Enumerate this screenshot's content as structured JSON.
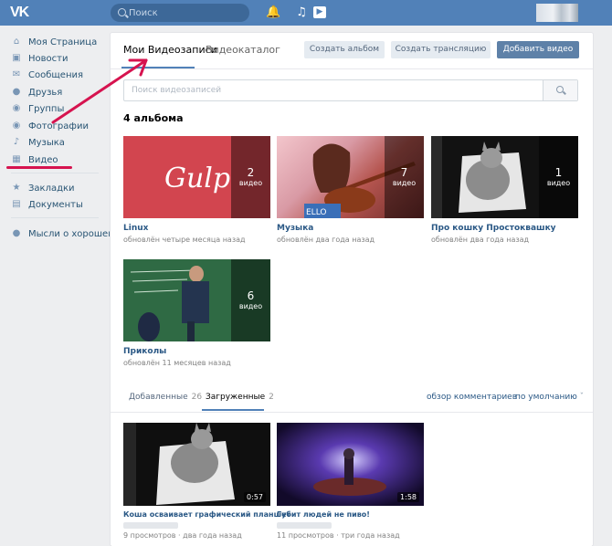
{
  "header": {
    "search_placeholder": "Поиск",
    "logo_icon": "vk-logo-icon",
    "icons": [
      "bell-icon",
      "music-icon",
      "play-icon"
    ]
  },
  "sidebar": {
    "items": [
      {
        "label": "Моя Страница",
        "icon": "home-icon"
      },
      {
        "label": "Новости",
        "icon": "news-icon"
      },
      {
        "label": "Сообщения",
        "icon": "messages-icon"
      },
      {
        "label": "Друзья",
        "icon": "friends-icon"
      },
      {
        "label": "Группы",
        "icon": "groups-icon"
      },
      {
        "label": "Фотографии",
        "icon": "camera-icon"
      },
      {
        "label": "Музыка",
        "icon": "music-icon"
      },
      {
        "label": "Видео",
        "icon": "video-icon"
      },
      {
        "label": "Закладки",
        "icon": "star-icon"
      },
      {
        "label": "Документы",
        "icon": "document-icon"
      },
      {
        "label": "Мысли о хорошем...",
        "icon": "community-icon"
      }
    ]
  },
  "main": {
    "tabs": [
      {
        "label": "Мои Видеозаписи",
        "active": true
      },
      {
        "label": "Видеокаталог",
        "active": false
      }
    ],
    "buttons": {
      "create_album": "Создать альбом",
      "create_stream": "Создать трансляцию",
      "add_video": "Добавить видео"
    },
    "search_placeholder": "Поиск видеозаписей",
    "albums_title": "4 альбома",
    "albums": [
      {
        "title": "Linux",
        "count": "2",
        "count_word": "видео",
        "updated": "обновлён четыре месяца назад"
      },
      {
        "title": "Музыка",
        "count": "7",
        "count_word": "видео",
        "updated": "обновлён два года назад"
      },
      {
        "title": "Про кошку Простоквашку",
        "count": "1",
        "count_word": "видео",
        "updated": "обновлён два года назад"
      },
      {
        "title": "Приколы",
        "count": "6",
        "count_word": "видео",
        "updated": "обновлён 11 месяцев назад"
      }
    ],
    "section_tabs": [
      {
        "label": "Добавленные",
        "count": "26",
        "active": false
      },
      {
        "label": "Загруженные",
        "count": "2",
        "active": true
      }
    ],
    "comments_link": "обзор комментариев",
    "sort_label": "по умолчанию",
    "videos": [
      {
        "title": "Коша осваивает графический планшет",
        "duration": "0:57",
        "views": "9 просмотров",
        "age": "два года назад"
      },
      {
        "title": "Губит людей не пиво!",
        "duration": "1:58",
        "views": "11 просмотров",
        "age": "три года назад"
      }
    ]
  },
  "colors": {
    "header": "#5181b8",
    "accent": "#5181b8",
    "annotation": "#d6134f"
  }
}
